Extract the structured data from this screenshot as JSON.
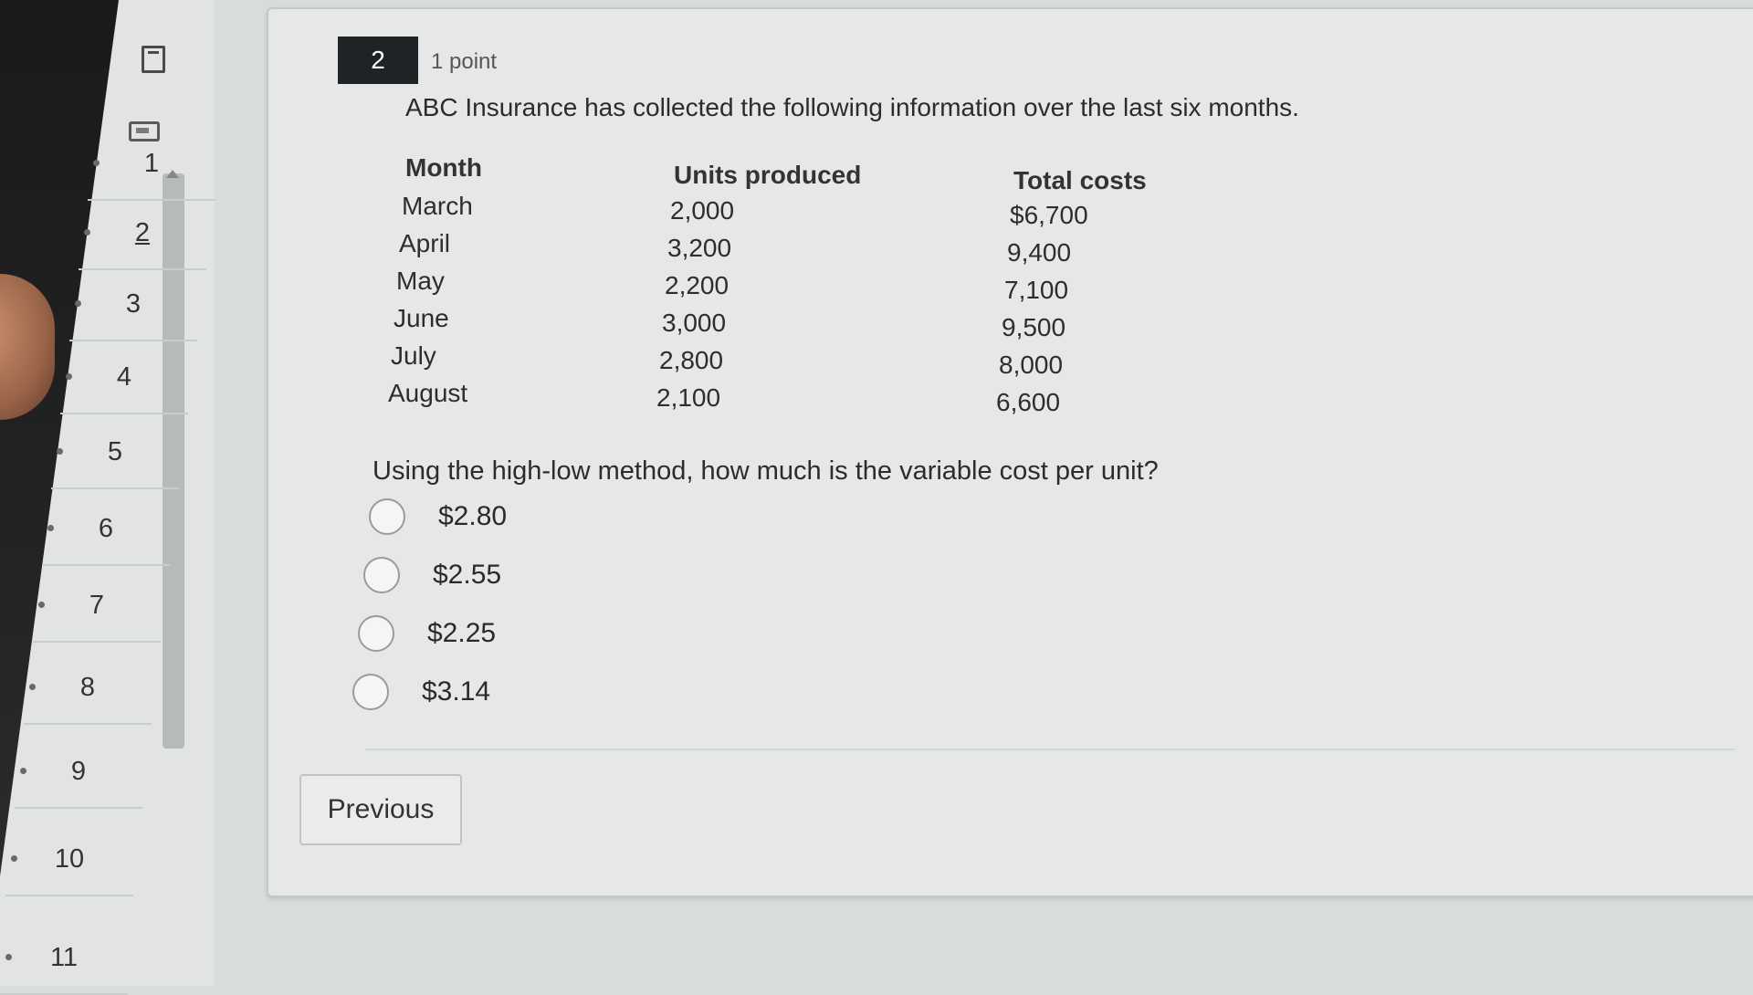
{
  "sidebar": {
    "tools": [
      {
        "name": "flag-icon"
      },
      {
        "name": "calculator-icon"
      }
    ],
    "questions": [
      "1",
      "2",
      "3",
      "4",
      "5",
      "6",
      "7",
      "8",
      "9",
      "10",
      "11"
    ],
    "current_question": "2"
  },
  "question": {
    "number": "2",
    "points": "1 point",
    "prompt": "ABC Insurance has collected the following information over the last six months.",
    "table": {
      "headers": [
        "Month",
        "Units produced",
        "Total costs"
      ],
      "rows": [
        [
          "March",
          "2,000",
          "$6,700"
        ],
        [
          "April",
          "3,200",
          "9,400"
        ],
        [
          "May",
          "2,200",
          "7,100"
        ],
        [
          "June",
          "3,000",
          "9,500"
        ],
        [
          "July",
          "2,800",
          "8,000"
        ],
        [
          "August",
          "2,100",
          "6,600"
        ]
      ]
    },
    "text": "Using the high-low method, how much is the variable cost per unit?",
    "options": [
      "$2.80",
      "$2.55",
      "$2.25",
      "$3.14"
    ]
  },
  "nav": {
    "previous_label": "Previous"
  }
}
